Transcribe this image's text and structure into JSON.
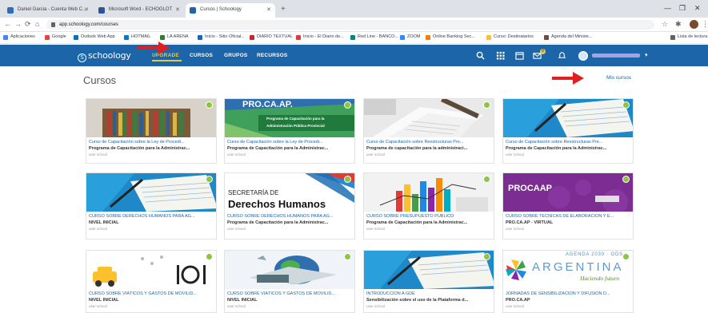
{
  "browser": {
    "tabs": [
      {
        "label": "Daniel Garcia - Cuenta Web C..."
      },
      {
        "label": "Microsoft Word - ECHOGLOT"
      },
      {
        "label": "Cursos | Schoology"
      }
    ],
    "url": "app.schoology.com/courses",
    "bookmarks": [
      "Aplicaciones",
      "Google",
      "Outlook Web App",
      "HOTMAIL",
      "LA ARENA",
      "Inicio - Sitio Oficial...",
      "DIARIO TEXTUAL",
      "Inicio - El Diario de...",
      "Red Line - BANCO...",
      "ZOOM",
      "Online Banking Sec...",
      "Curso: Destinatarios",
      "Agenda del Ministe...",
      "Lista de lectura"
    ]
  },
  "navbar": {
    "logo": "schoology",
    "upgrade": "UPGRADE",
    "links": [
      "CURSOS",
      "GRUPOS",
      "RECURSOS"
    ],
    "badge": "0"
  },
  "page": {
    "title": "Cursos",
    "my_courses": "Mis cursos"
  },
  "courses": [
    {
      "title": "Curso de Capacitación sobre la Ley de Procedi...",
      "section": "Programa de Capacitación para la Administrac...",
      "school": "user school",
      "image": "books"
    },
    {
      "title": "Curso de Capacitación sobre la Ley de Procedi...",
      "section": "Programa de Capacitación para la Administrac...",
      "school": "user school",
      "image": "procaap-classic",
      "banner_main": "PRO.CA.AP.",
      "banner_sub1": "Programa de Capacitación para la",
      "banner_sub2": "Administración Pública Provincial"
    },
    {
      "title": "Curso de Capacitación sobre Reestructuras Pre...",
      "section": "Programa de capacitación para la administraci...",
      "school": "user school",
      "image": "paperwork"
    },
    {
      "title": "Curso de Capacitación sobre Reestructuras Pre...",
      "section": "Programa de Capacitación para la Administrac...",
      "school": "user school",
      "image": "notebook"
    },
    {
      "title": "CURSO SOBRE DERECHOS HUMANOS PARA AG...",
      "section": "NIVEL INICIAL",
      "school": "user school",
      "image": "notebook"
    },
    {
      "title": "CURSO SOBRE DERECHOS HUMANOS PARA AG...",
      "section": "Programa de Capacitación para la Administrac...",
      "school": "user school",
      "image": "derechos",
      "banner_main": "SECRETARÍA DE",
      "banner_sub1": "Derechos Humanos"
    },
    {
      "title": "CURSO SOBRE PRESUPUESTO PUBLICO",
      "section": "Programa de Capacitación para la Administrac...",
      "school": "user school",
      "image": "charts"
    },
    {
      "title": "CURSO SOBRE TECNICAS DE ELABORACION Y E...",
      "section": "PRO.CA.AP - VIRTUAL",
      "school": "user school",
      "image": "procaap-purple",
      "banner_main": "PROCAAP"
    },
    {
      "title": "CURSO SOBRE VIÁTICOS Y GASTOS DE MOVILID...",
      "section": "NIVEL INICIAL",
      "school": "user school",
      "image": "taxi"
    },
    {
      "title": "CURSO SOBRE VIÁTICOS Y GASTOS DE MOVILID...",
      "section": "NIVEL INICIAL",
      "school": "user school",
      "image": "travel"
    },
    {
      "title": "INTRODUCCION A GDE",
      "section": "Sensibilización sobre el uso de la Plataforma d...",
      "school": "user school",
      "image": "notebook"
    },
    {
      "title": "JORNADAS DE SENSIBILIZACION Y DIFUSION D...",
      "section": "PRO.CA.AP",
      "school": "user school",
      "image": "agenda",
      "banner_main": "ARGENTINA",
      "banner_sub1": "AGENDA 2030 · ODS",
      "banner_sub2": "Haciendo futuro"
    }
  ],
  "colors": {
    "navbar": "#1c65a8",
    "accent": "#e8c84a",
    "link": "#1c65a8",
    "annotation_arrow": "#e02020"
  }
}
